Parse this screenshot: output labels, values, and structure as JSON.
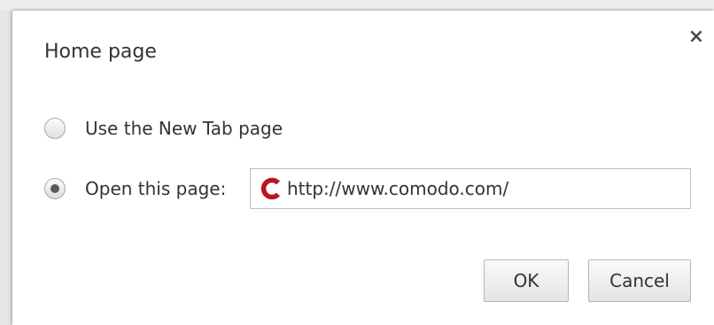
{
  "dialog": {
    "title": "Home page",
    "close_symbol": "×",
    "options": [
      {
        "label": "Use the New Tab page",
        "checked": false
      },
      {
        "label": "Open this page:",
        "checked": true
      }
    ],
    "url_field": {
      "value": "http://www.comodo.com/",
      "favicon": "comodo-c-icon",
      "favicon_color": "#c0121c"
    },
    "buttons": {
      "ok": "OK",
      "cancel": "Cancel"
    }
  }
}
